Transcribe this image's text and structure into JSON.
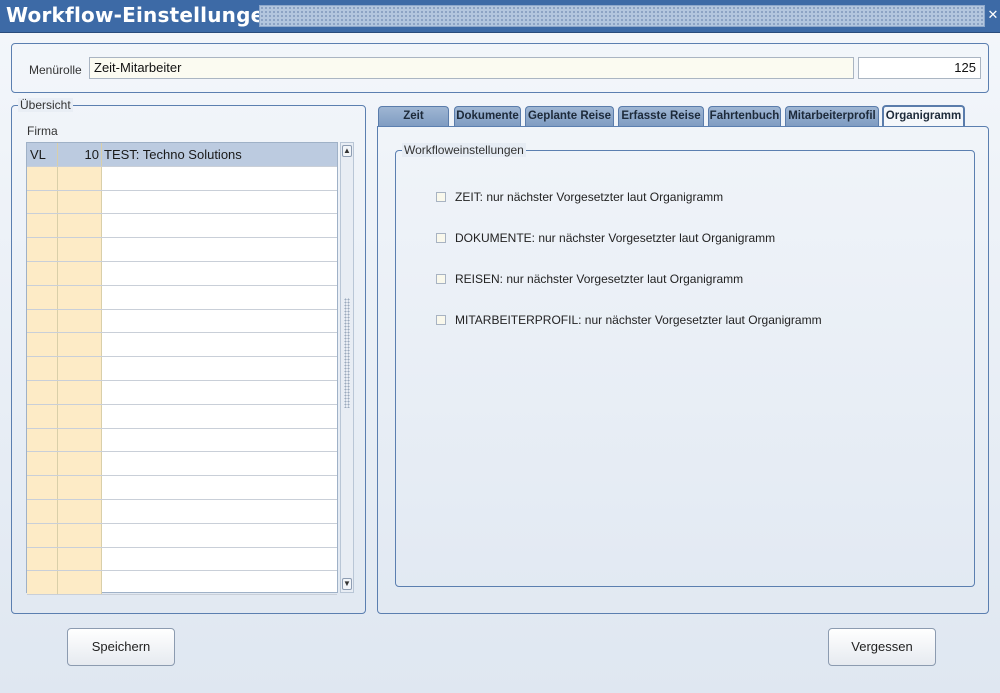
{
  "window": {
    "title": "Workflow-Einstellungen",
    "close_symbol": "✕"
  },
  "menu_role": {
    "label": "Menürolle",
    "value": "Zeit-Mitarbeiter",
    "id_value": "125"
  },
  "overview": {
    "legend": "Übersicht",
    "column_label": "Firma",
    "rows": [
      {
        "code": "VL",
        "number": "10",
        "name": "TEST: Techno Solutions"
      }
    ],
    "scroll_up_symbol": "▲",
    "scroll_down_symbol": "▼"
  },
  "tabs": [
    {
      "label": "Zeit"
    },
    {
      "label": "Dokumente"
    },
    {
      "label": "Geplante Reise"
    },
    {
      "label": "Erfasste Reise"
    },
    {
      "label": "Fahrtenbuch"
    },
    {
      "label": "Mitarbeiterprofil"
    },
    {
      "label": "Organigramm"
    }
  ],
  "active_tab": "Organigramm",
  "workflow": {
    "legend": "Workfloweinstellungen",
    "options": [
      {
        "label": "ZEIT: nur nächster Vorgesetzter laut Organigramm",
        "checked": false
      },
      {
        "label": "DOKUMENTE: nur nächster Vorgesetzter laut Organigramm",
        "checked": false
      },
      {
        "label": "REISEN: nur nächster Vorgesetzter laut Organigramm",
        "checked": false
      },
      {
        "label": "MITARBEITERPROFIL: nur nächster Vorgesetzter laut Organigramm",
        "checked": false
      }
    ]
  },
  "buttons": {
    "save": "Speichern",
    "discard": "Vergessen"
  },
  "colors": {
    "titlebar": "#3d6aa6",
    "frame": "#5b7fb0",
    "grid_highlight": "#fdebc6",
    "selected_row": "#bccbe0",
    "tab": "#8fa9cb"
  }
}
